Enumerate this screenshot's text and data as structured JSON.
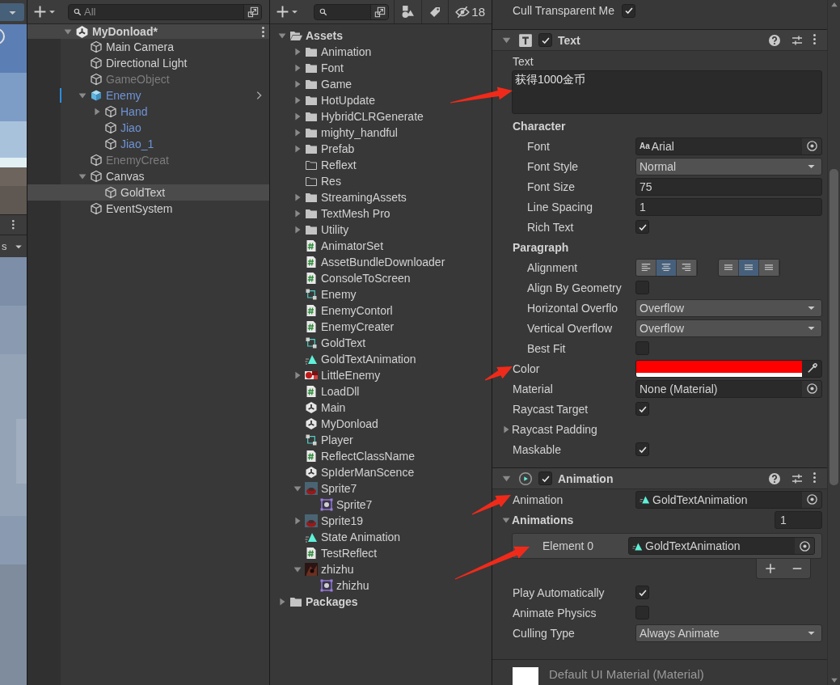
{
  "scene_view": {
    "toolbar_text": "s"
  },
  "hierarchy": {
    "search": {
      "placeholder": "All"
    },
    "scene": {
      "name": "MyDonload*",
      "expanded": true
    },
    "items": [
      {
        "label": "Main Camera",
        "kind": "object",
        "disabled": false,
        "selected": false
      },
      {
        "label": "Directional Light",
        "kind": "object",
        "disabled": false,
        "selected": false
      },
      {
        "label": "GameObject",
        "kind": "object",
        "disabled": true,
        "selected": false
      },
      {
        "label": "Enemy",
        "kind": "prefab_root",
        "disabled": false,
        "selected": false,
        "expanded": true,
        "children": [
          {
            "label": "Hand",
            "kind": "prefab_child",
            "disabled": false,
            "selected": false,
            "expanded": false
          },
          {
            "label": "Jiao",
            "kind": "prefab_child",
            "disabled": false,
            "selected": false
          },
          {
            "label": "Jiao_1",
            "kind": "prefab_child",
            "disabled": false,
            "selected": false
          }
        ]
      },
      {
        "label": "EnemyCreat",
        "kind": "object",
        "disabled": true,
        "selected": false
      },
      {
        "label": "Canvas",
        "kind": "object",
        "disabled": false,
        "selected": false,
        "expanded": true,
        "children": [
          {
            "label": "GoldText",
            "kind": "object",
            "disabled": false,
            "selected": true
          }
        ]
      },
      {
        "label": "EventSystem",
        "kind": "object",
        "disabled": false,
        "selected": false
      }
    ]
  },
  "project": {
    "hidden_count": "18",
    "tree": [
      {
        "label": "Assets",
        "kind": "root",
        "selected": false,
        "expanded": true,
        "children": [
          {
            "label": "Animation",
            "kind": "folder",
            "selected": false,
            "expanded": false
          },
          {
            "label": "Font",
            "kind": "folder",
            "selected": false,
            "expanded": false
          },
          {
            "label": "Game",
            "kind": "folder",
            "selected": false,
            "expanded": false
          },
          {
            "label": "HotUpdate",
            "kind": "folder",
            "selected": false,
            "expanded": false
          },
          {
            "label": "HybridCLRGenerate",
            "kind": "folder",
            "selected": false,
            "expanded": false
          },
          {
            "label": "mighty_handful",
            "kind": "folder",
            "selected": false,
            "expanded": false
          },
          {
            "label": "Prefab",
            "kind": "folder",
            "selected": false,
            "expanded": false
          },
          {
            "label": "Reflext",
            "kind": "empty_folder",
            "selected": false
          },
          {
            "label": "Res",
            "kind": "empty_folder",
            "selected": false
          },
          {
            "label": "StreamingAssets",
            "kind": "folder",
            "selected": false,
            "expanded": false
          },
          {
            "label": "TextMesh Pro",
            "kind": "folder",
            "selected": false,
            "expanded": false
          },
          {
            "label": "Utility",
            "kind": "folder",
            "selected": false,
            "expanded": false
          },
          {
            "label": "AnimatorSet",
            "kind": "script",
            "selected": false
          },
          {
            "label": "AssetBundleDownloader",
            "kind": "script",
            "selected": false
          },
          {
            "label": "ConsoleToScreen",
            "kind": "script",
            "selected": false
          },
          {
            "label": "Enemy",
            "kind": "animator",
            "selected": false
          },
          {
            "label": "EnemyContorl",
            "kind": "script",
            "selected": false
          },
          {
            "label": "EnemyCreater",
            "kind": "script",
            "selected": false
          },
          {
            "label": "GoldText",
            "kind": "animator",
            "selected": false
          },
          {
            "label": "GoldTextAnimation",
            "kind": "animation",
            "selected": false
          },
          {
            "label": "LittleEnemy",
            "kind": "model",
            "selected": false,
            "expanded": false
          },
          {
            "label": "LoadDll",
            "kind": "script",
            "selected": false
          },
          {
            "label": "Main",
            "kind": "scene",
            "selected": false
          },
          {
            "label": "MyDonload",
            "kind": "scene",
            "selected": false
          },
          {
            "label": "Player",
            "kind": "animator",
            "selected": false
          },
          {
            "label": "ReflectClassName",
            "kind": "script",
            "selected": false
          },
          {
            "label": "SpIderManScence",
            "kind": "scene",
            "selected": false
          },
          {
            "label": "Sprite7",
            "kind": "texture",
            "selected": false,
            "expanded": true,
            "children": [
              {
                "label": "Sprite7",
                "kind": "sprite",
                "selected": false
              }
            ]
          },
          {
            "label": "Sprite19",
            "kind": "texture",
            "selected": false,
            "expanded": false
          },
          {
            "label": "State Animation",
            "kind": "animation",
            "selected": false
          },
          {
            "label": "TestReflect",
            "kind": "script",
            "selected": false
          },
          {
            "label": "zhizhu",
            "kind": "texture_dark",
            "selected": false,
            "expanded": true,
            "children": [
              {
                "label": "zhizhu",
                "kind": "sprite",
                "selected": false
              }
            ]
          }
        ]
      },
      {
        "label": "Packages",
        "kind": "root",
        "selected": false,
        "expanded": false
      }
    ]
  },
  "inspector": {
    "rows": [
      {
        "kind": "checkbox",
        "label": "Cull Transparent Me",
        "checked": true
      }
    ],
    "components": [
      {
        "title": "Text",
        "kind": "text",
        "enabled": true,
        "expanded": true,
        "rows": [
          {
            "kind": "textarea",
            "label": "Text",
            "value": "获得1000金币"
          },
          {
            "kind": "section",
            "label": "Character",
            "children": [
              {
                "kind": "object",
                "label": "Font",
                "value": "Arial",
                "badge": "Aa"
              },
              {
                "kind": "dropdown",
                "label": "Font Style",
                "value": "Normal"
              },
              {
                "kind": "input",
                "label": "Font Size",
                "value": "75"
              },
              {
                "kind": "input",
                "label": "Line Spacing",
                "value": "1"
              },
              {
                "kind": "checkbox",
                "label": "Rich Text",
                "checked": true
              }
            ]
          },
          {
            "kind": "section",
            "label": "Paragraph",
            "children": [
              {
                "kind": "alignment",
                "label": "Alignment",
                "horizontal": [
                  {
                    "selected": false
                  },
                  {
                    "selected": true
                  },
                  {
                    "selected": false
                  }
                ],
                "vertical": [
                  {
                    "selected": false
                  },
                  {
                    "selected": true
                  },
                  {
                    "selected": false
                  }
                ]
              },
              {
                "kind": "checkbox",
                "label": "Align By Geometry",
                "checked": false
              },
              {
                "kind": "dropdown",
                "label": "Horizontal Overflo",
                "value": "Overflow"
              },
              {
                "kind": "dropdown",
                "label": "Vertical Overflow",
                "value": "Overflow"
              },
              {
                "kind": "checkbox",
                "label": "Best Fit",
                "checked": false
              }
            ]
          },
          {
            "kind": "color",
            "label": "Color",
            "color": "#ff0000"
          },
          {
            "kind": "object",
            "label": "Material",
            "value": "None (Material)"
          },
          {
            "kind": "checkbox",
            "label": "Raycast Target",
            "checked": true
          },
          {
            "kind": "foldout",
            "label": "Raycast Padding",
            "expanded": false
          },
          {
            "kind": "checkbox",
            "label": "Maskable",
            "checked": true
          }
        ]
      },
      {
        "title": "Animation",
        "kind": "animation",
        "enabled": true,
        "expanded": true,
        "rows": [
          {
            "kind": "clip",
            "label": "Animation",
            "value": "GoldTextAnimation"
          },
          {
            "kind": "array",
            "label": "Animations",
            "expanded": true,
            "size": "1",
            "elements": [
              {
                "kind": "clip",
                "label": "Element 0",
                "value": "GoldTextAnimation"
              }
            ]
          },
          {
            "kind": "checkbox",
            "label": "Play Automatically",
            "checked": true
          },
          {
            "kind": "checkbox",
            "label": "Animate Physics",
            "checked": false
          },
          {
            "kind": "dropdown",
            "label": "Culling Type",
            "value": "Always Animate"
          }
        ]
      }
    ],
    "material_preview": {
      "name": "Default UI Material (Material)"
    }
  }
}
